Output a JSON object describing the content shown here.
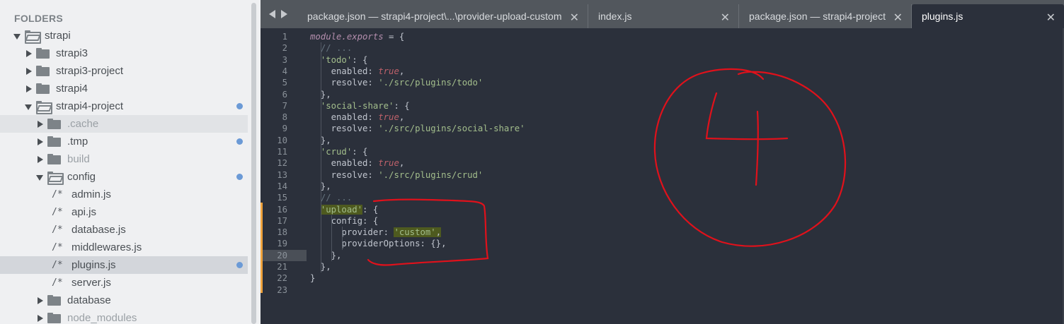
{
  "sidebar": {
    "header": "FOLDERS",
    "tree": [
      {
        "label": "strapi",
        "kind": "folder-open",
        "depth": 0,
        "arrow": "down",
        "dot": false,
        "state": ""
      },
      {
        "label": "strapi3",
        "kind": "folder",
        "depth": 1,
        "arrow": "right",
        "dot": false,
        "state": ""
      },
      {
        "label": "strapi3-project",
        "kind": "folder",
        "depth": 1,
        "arrow": "right",
        "dot": false,
        "state": ""
      },
      {
        "label": "strapi4",
        "kind": "folder",
        "depth": 1,
        "arrow": "right",
        "dot": false,
        "state": ""
      },
      {
        "label": "strapi4-project",
        "kind": "folder-open",
        "depth": 1,
        "arrow": "down",
        "dot": true,
        "state": ""
      },
      {
        "label": ".cache",
        "kind": "folder",
        "depth": 2,
        "arrow": "right",
        "dot": false,
        "state": "hl dim"
      },
      {
        "label": ".tmp",
        "kind": "folder",
        "depth": 2,
        "arrow": "right",
        "dot": true,
        "state": ""
      },
      {
        "label": "build",
        "kind": "folder",
        "depth": 2,
        "arrow": "right",
        "dot": false,
        "state": "dim"
      },
      {
        "label": "config",
        "kind": "folder-open",
        "depth": 2,
        "arrow": "down",
        "dot": true,
        "state": ""
      },
      {
        "label": "admin.js",
        "kind": "file",
        "depth": 3,
        "arrow": "",
        "dot": false,
        "state": ""
      },
      {
        "label": "api.js",
        "kind": "file",
        "depth": 3,
        "arrow": "",
        "dot": false,
        "state": ""
      },
      {
        "label": "database.js",
        "kind": "file",
        "depth": 3,
        "arrow": "",
        "dot": false,
        "state": ""
      },
      {
        "label": "middlewares.js",
        "kind": "file",
        "depth": 3,
        "arrow": "",
        "dot": false,
        "state": ""
      },
      {
        "label": "plugins.js",
        "kind": "file",
        "depth": 3,
        "arrow": "",
        "dot": true,
        "state": "sel"
      },
      {
        "label": "server.js",
        "kind": "file",
        "depth": 3,
        "arrow": "",
        "dot": false,
        "state": ""
      },
      {
        "label": "database",
        "kind": "folder",
        "depth": 2,
        "arrow": "right",
        "dot": false,
        "state": ""
      },
      {
        "label": "node_modules",
        "kind": "folder",
        "depth": 2,
        "arrow": "right",
        "dot": false,
        "state": "dim"
      }
    ],
    "file_icon_glyph": "/*"
  },
  "tabs": [
    {
      "label": "package.json — strapi4-project\\...\\provider-upload-custom",
      "active": false
    },
    {
      "label": "index.js",
      "active": false
    },
    {
      "label": "package.json — strapi4-project",
      "active": false
    },
    {
      "label": "plugins.js",
      "active": true
    }
  ],
  "close_glyph": "✕",
  "editor": {
    "current_line": 20,
    "lines": [
      [
        [
          "k-it",
          "module.exports"
        ],
        [
          "k-pl",
          " = {"
        ]
      ],
      [
        [
          "k-pl",
          "  "
        ],
        [
          "k-cmt",
          "// ..."
        ]
      ],
      [
        [
          "k-pl",
          "  "
        ],
        [
          "k-str",
          "'todo'"
        ],
        [
          "k-pl",
          ": {"
        ]
      ],
      [
        [
          "k-pl",
          "    enabled: "
        ],
        [
          "k-bool",
          "true"
        ],
        [
          "k-pl",
          ","
        ]
      ],
      [
        [
          "k-pl",
          "    resolve: "
        ],
        [
          "k-str",
          "'./src/plugins/todo'"
        ]
      ],
      [
        [
          "k-pl",
          "  },"
        ]
      ],
      [
        [
          "k-pl",
          "  "
        ],
        [
          "k-str",
          "'social-share'"
        ],
        [
          "k-pl",
          ": {"
        ]
      ],
      [
        [
          "k-pl",
          "    enabled: "
        ],
        [
          "k-bool",
          "true"
        ],
        [
          "k-pl",
          ","
        ]
      ],
      [
        [
          "k-pl",
          "    resolve: "
        ],
        [
          "k-str",
          "'./src/plugins/social-share'"
        ]
      ],
      [
        [
          "k-pl",
          "  },"
        ]
      ],
      [
        [
          "k-pl",
          "  "
        ],
        [
          "k-str",
          "'crud'"
        ],
        [
          "k-pl",
          ": {"
        ]
      ],
      [
        [
          "k-pl",
          "    enabled: "
        ],
        [
          "k-bool",
          "true"
        ],
        [
          "k-pl",
          ","
        ]
      ],
      [
        [
          "k-pl",
          "    resolve: "
        ],
        [
          "k-str",
          "'./src/plugins/crud'"
        ]
      ],
      [
        [
          "k-pl",
          "  },"
        ]
      ],
      [
        [
          "k-pl",
          "  "
        ],
        [
          "k-cmt",
          "// ..."
        ]
      ],
      [
        [
          "k-pl",
          "  "
        ],
        [
          "k-str k-hl",
          "'upload'"
        ],
        [
          "k-pl",
          ": {"
        ]
      ],
      [
        [
          "k-pl",
          "    config: {"
        ]
      ],
      [
        [
          "k-pl",
          "      provider: "
        ],
        [
          "k-str k-hl",
          "'custom'"
        ],
        [
          "k-pl k-hl",
          ","
        ]
      ],
      [
        [
          "k-pl",
          "      providerOptions: {},"
        ]
      ],
      [
        [
          "k-pl",
          "    },"
        ]
      ],
      [
        [
          "k-pl",
          "  },"
        ]
      ],
      [
        [
          "k-pl",
          "}"
        ]
      ],
      [
        [
          "k-pl",
          ""
        ]
      ]
    ]
  },
  "colors": {
    "annotation_red": "#e0111b",
    "modified_dot": "#6b9ad6",
    "edit_marker": "#f0a33d"
  }
}
